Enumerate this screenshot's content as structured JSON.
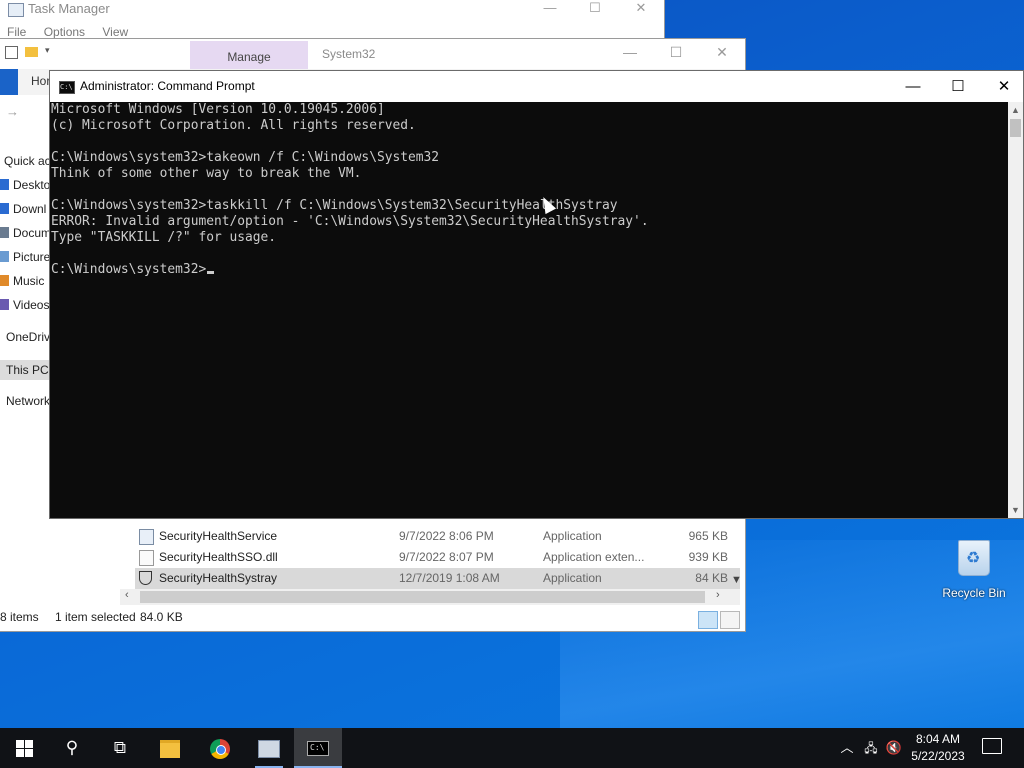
{
  "task_manager": {
    "title": "Task Manager",
    "menu": [
      "File",
      "Options",
      "View"
    ],
    "controls": [
      "—",
      "☐",
      "✕"
    ]
  },
  "explorer": {
    "manage_tab": "Manage",
    "title": "System32",
    "home_tab": "Hor",
    "controls": [
      "—",
      "☐",
      "✕"
    ],
    "sidebar": [
      {
        "label": "Quick ac",
        "color": "#2a6bd1"
      },
      {
        "label": "Deskto",
        "color": "#2a6bd1"
      },
      {
        "label": "Downl",
        "color": "#2a6bd1"
      },
      {
        "label": "Docum",
        "color": "#6a7b90"
      },
      {
        "label": "Picture",
        "color": "#6a9bd1"
      },
      {
        "label": "Music",
        "color": "#e08a2a"
      },
      {
        "label": "Videos",
        "color": "#6a5ab0"
      },
      {
        "label": "OneDriv",
        "color": "#1c7bd8"
      },
      {
        "label": "This PC",
        "color": "#3c8ad8"
      },
      {
        "label": "Network",
        "color": "#3c8ad8"
      }
    ],
    "files": [
      {
        "name": "SecurityHealthService",
        "date": "9/7/2022 8:06 PM",
        "type": "Application",
        "size": "965 KB",
        "icon": "app-icon"
      },
      {
        "name": "SecurityHealthSSO.dll",
        "date": "9/7/2022 8:07 PM",
        "type": "Application exten...",
        "size": "939 KB",
        "icon": "dll-icon"
      },
      {
        "name": "SecurityHealthSystray",
        "date": "12/7/2019 1:08 AM",
        "type": "Application",
        "size": "84 KB",
        "icon": "shield-icon"
      }
    ],
    "status": {
      "items": "8 items",
      "selected": "1 item selected",
      "size": "84.0 KB"
    }
  },
  "cmd": {
    "title": "Administrator: Command Prompt",
    "controls": [
      "—",
      "☐",
      "✕"
    ],
    "lines": [
      "Microsoft Windows [Version 10.0.19045.2006]",
      "(c) Microsoft Corporation. All rights reserved.",
      "",
      "C:\\Windows\\system32>takeown /f C:\\Windows\\System32",
      "Think of some other way to break the VM.",
      "",
      "C:\\Windows\\system32>taskkill /f C:\\Windows\\System32\\SecurityHealthSystray",
      "ERROR: Invalid argument/option - 'C:\\Windows\\System32\\SecurityHealthSystray'.",
      "Type \"TASKKILL /?\" for usage.",
      ""
    ],
    "prompt": "C:\\Windows\\system32>"
  },
  "desktop": {
    "recycle_bin": "Recycle Bin"
  },
  "taskbar": {
    "time": "8:04 AM",
    "date": "5/22/2023"
  }
}
